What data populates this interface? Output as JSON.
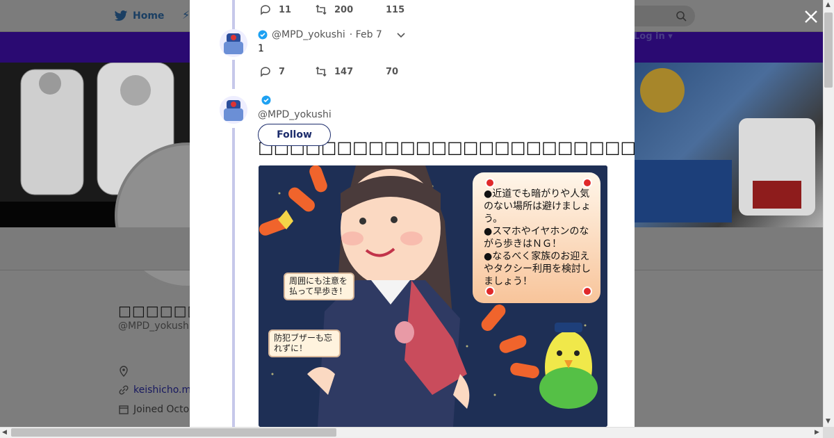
{
  "background": {
    "nav_home_label": "Home",
    "login_label": "Log in",
    "profile_name": "□□□□□□□□□□",
    "profile_handle": "@MPD_yokush",
    "profile_link": "keishicho.m",
    "profile_joined": "Joined Octo"
  },
  "thread": {
    "tweet1": {
      "replies": "11",
      "retweets": "200",
      "likes": "115"
    },
    "tweet2": {
      "handle": "@MPD_yokushi",
      "date": "· Feb 7",
      "text": "1",
      "replies": "7",
      "retweets": "147",
      "likes": "70"
    },
    "tweet3": {
      "handle": "@MPD_yokushi",
      "follow_label": "Follow",
      "text": "□□□□□□□□□□□□□□□□□□□□□□□□□□□□□□□□□□□□□□□□□□□□□□□□□□"
    }
  },
  "illustration": {
    "notice_lines": [
      "●近道でも暗がりや人気のない場所は避けましょう。",
      "●スマホやイヤホンのながら歩きはＮＧ！",
      "●なるべく家族のお迎えやタクシー利用を検討しましょう！"
    ],
    "bubble1": "周囲にも注意を払って早歩き！",
    "bubble2": "防犯ブザーも忘れずに！"
  },
  "colors": {
    "accent_blue": "#1da1f2",
    "thread_line": "#c6c8ea",
    "purple_bar": "#2a0a72",
    "overlay_gray": "#7d7d7d"
  }
}
